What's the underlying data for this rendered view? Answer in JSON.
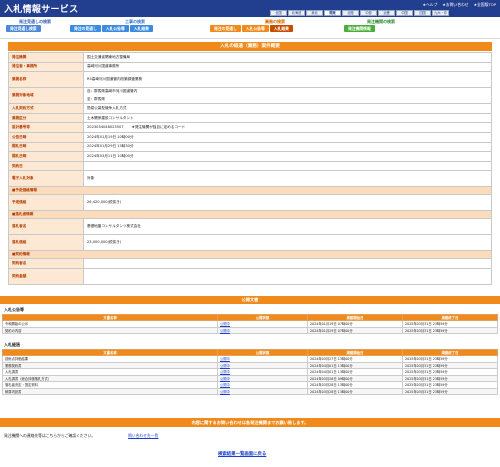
{
  "header": {
    "title": "入札情報サービス",
    "links": [
      "★ヘルプ",
      "★お問い合わせ",
      "★全国版TOP"
    ],
    "regions": [
      "全国",
      "北海道",
      "東北",
      "関東",
      "北陸",
      "中部",
      "近畿",
      "中国",
      "四国",
      "九州・沖縄"
    ]
  },
  "categories": {
    "cat1": {
      "title": "発注見通しの検索",
      "buttons": [
        "発注見通し検索"
      ]
    },
    "cat2": {
      "title": "工事の検索",
      "buttons": [
        "発注の見通し",
        "入札公告等",
        "入札結果"
      ]
    },
    "cat3": {
      "title": "業務の検索",
      "buttons": [
        "発注の見通し",
        "入札公告等",
        "入札結果"
      ]
    },
    "cat4": {
      "title": "発注機関の検索",
      "buttons": [
        "発注機関情報"
      ]
    }
  },
  "detail": {
    "heading": "入札の経過（業務）案件概要",
    "rows": [
      {
        "key": "発注機関",
        "value": "国土交通省関東地方整備局"
      },
      {
        "key": "発注者・事務所",
        "value": "高崎河川国道事務所"
      },
      {
        "key": "業務名称",
        "value": "R5高崎河川国道管内改築調査業務"
      },
      {
        "key": "業務対象地域",
        "value": "自：群馬県高崎市河川国道管内",
        "value2": "至：群馬県"
      },
      {
        "key": "入札契約方式",
        "value": "簡易公募型競争入札方式"
      },
      {
        "key": "業務区分",
        "value": "土木関係建設コンサルタント"
      },
      {
        "key": "設計番号等",
        "value": "2023034048023507",
        "note": "★発注機関が独自に定めるコード"
      },
      {
        "key": "公告日時",
        "value": "2024年01月19日 10時00分"
      },
      {
        "key": "開札日時",
        "value": "2024年01月29日 13時30分"
      },
      {
        "key": "開札日時",
        "value": "2024年03月11日 10時00分"
      },
      {
        "key": "契約日",
        "value": ""
      },
      {
        "key": "電子入札対象",
        "value": "対象"
      }
    ],
    "section1": "■予定価格情報",
    "rows2": [
      {
        "key": "予定価格",
        "value": "26,420,000(税抜き)"
      }
    ],
    "section2": "■落札者情報",
    "rows3": [
      {
        "key": "落札者名",
        "value": "基礎地盤コンサルタンツ株式会社"
      },
      {
        "key": "落札価格",
        "value": "23,000,000(税抜き)"
      }
    ],
    "section3": "■契約情報",
    "rows4": [
      {
        "key": "契約者名",
        "value": ""
      },
      {
        "key": "契約金額",
        "value": ""
      }
    ]
  },
  "docs": {
    "heading": "公開文書",
    "group1": {
      "title": "入札公告等",
      "headers": [
        "文書名称",
        "公開状態",
        "掲載開始日",
        "掲載終了日"
      ],
      "rows": [
        [
          "令和開始の公示",
          "公開中",
          "2024年01月19日 07時00分",
          "2025年03月31日 23時59分"
        ],
        [
          "契約の内容",
          "公開中",
          "2024年01月29日 07時00分",
          "2025年03月31日 23時59分"
        ]
      ]
    },
    "group2": {
      "title": "入札経過",
      "headers": [
        "文書名称",
        "公開状態",
        "掲載開始日",
        "掲載終了日"
      ],
      "rows": [
        [
          "技術点評価結果",
          "公開中",
          "2024年03月27日 13時00分",
          "2025年03月31日 23時59分"
        ],
        [
          "業務契約書",
          "公開中",
          "2024年04月01日 13時00分",
          "2025年03月31日 23時59分"
        ],
        [
          "入札調書",
          "公開中",
          "2024年04月01日 13時00分",
          "2025年03月31日 23時59分"
        ],
        [
          "入札調書（総合評価落札方式）",
          "公開中",
          "2024年03月28日 09時00分",
          "2025年03月31日 23時59分"
        ],
        [
          "落札者決定・選定資料",
          "公開中",
          "2024年03月28日 13時00分",
          "2025年03月31日 23時59分"
        ],
        [
          "積算内訳書",
          "公開中",
          "2024年03月28日 13時00分",
          "2025年03月31日 23時59分"
        ]
      ]
    }
  },
  "footer": {
    "bar": "内容に関するお問い合わせは各発注機関までお願い致します。",
    "note": "発注機関への連絡先等はこちらからご確認ください。",
    "link": "問い合わせ先一覧",
    "back": "検索結果一覧画面に戻る"
  }
}
